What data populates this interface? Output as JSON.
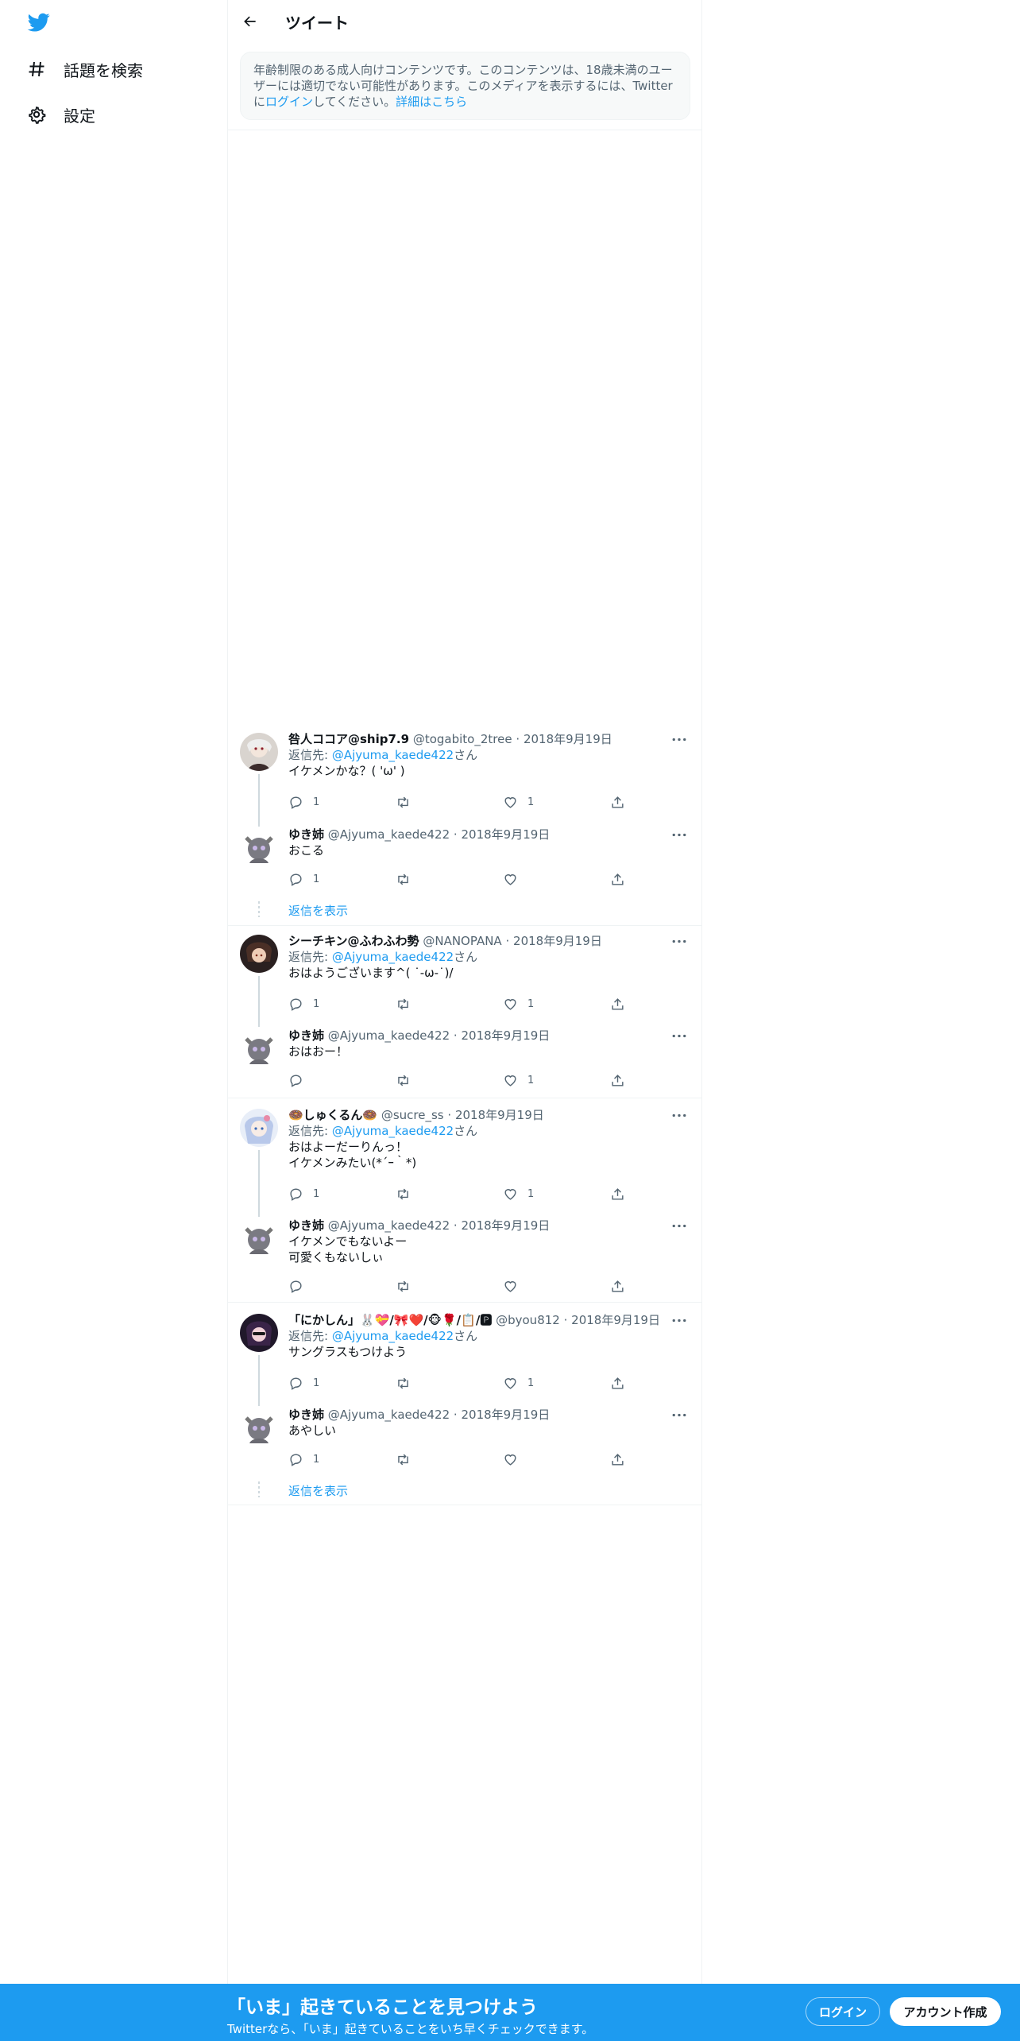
{
  "nav": {
    "explore_label": "話題を検索",
    "settings_label": "設定"
  },
  "header": {
    "title": "ツイート"
  },
  "notice": {
    "text1": "年齢制限のある成人向けコンテンツです。このコンテンツは、18歳未満のユーザーには適切でない可能性があります。このメディアを表示するには、Twitter",
    "text2": "に",
    "login_link": "ログイン",
    "text3": "してください。",
    "learn_more": "詳細はこちら"
  },
  "threads": [
    {
      "reply": {
        "name": "咎人ココア@ship7.9",
        "handle": "@togabito_2tree",
        "date": "2018年9月19日",
        "reply_prefix": "返信先: ",
        "reply_to": "@Ajyuma_kaede422",
        "reply_suffix": "さん",
        "text": "イケメンかな？( 'ω' )",
        "replies": "1",
        "retweets": "",
        "likes": "1"
      },
      "answer": {
        "name": "ゆき姉",
        "handle": "@Ajyuma_kaede422",
        "date": "2018年9月19日",
        "text": "おこる",
        "replies": "1",
        "retweets": "",
        "likes": ""
      },
      "show_replies": "返信を表示"
    },
    {
      "reply": {
        "name": "シーチキン@ふわふわ勢",
        "handle": "@NANOPANA",
        "date": "2018年9月19日",
        "reply_prefix": "返信先: ",
        "reply_to": "@Ajyuma_kaede422",
        "reply_suffix": "さん",
        "text": "おはようございます^( ˙-ω-˙)/",
        "replies": "1",
        "retweets": "",
        "likes": "1"
      },
      "answer": {
        "name": "ゆき姉",
        "handle": "@Ajyuma_kaede422",
        "date": "2018年9月19日",
        "text": "おはおー！",
        "replies": "",
        "retweets": "",
        "likes": "1"
      }
    },
    {
      "reply": {
        "name": "🍩しゅくるん🍩",
        "handle": "@sucre_ss",
        "date": "2018年9月19日",
        "reply_prefix": "返信先: ",
        "reply_to": "@Ajyuma_kaede422",
        "reply_suffix": "さん",
        "text_line1": "おはよーだーりんっ！",
        "text_line2": "イケメンみたい(*´ｰ｀*)",
        "replies": "1",
        "retweets": "",
        "likes": "1"
      },
      "answer": {
        "name": "ゆき姉",
        "handle": "@Ajyuma_kaede422",
        "date": "2018年9月19日",
        "text_line1": "イケメンでもないよー",
        "text_line2": "可愛くもないしぃ",
        "replies": "",
        "retweets": "",
        "likes": ""
      }
    },
    {
      "reply": {
        "name": "「にかしん」🐰💝/🎀❤️/🐵🌹/📋/🅿",
        "handle": "@byou812",
        "date": "2018年9月19日",
        "reply_prefix": "返信先: ",
        "reply_to": "@Ajyuma_kaede422",
        "reply_suffix": "さん",
        "text": "サングラスもつけよう",
        "replies": "1",
        "retweets": "",
        "likes": "1"
      },
      "answer": {
        "name": "ゆき姉",
        "handle": "@Ajyuma_kaede422",
        "date": "2018年9月19日",
        "text": "あやしい",
        "replies": "1",
        "retweets": "",
        "likes": ""
      },
      "show_replies": "返信を表示"
    }
  ],
  "separator_dot": "·",
  "bottom": {
    "title": "「いま」起きていることを見つけよう",
    "subtitle": "Twitterなら、「いま」起きていることをいち早くチェックできます。",
    "login": "ログイン",
    "signup": "アカウント作成"
  },
  "colors": {
    "accent": "#1d9bf0",
    "muted": "#536471",
    "border": "#eff3f4"
  },
  "icons": [
    "twitter-logo-icon",
    "hashtag-icon",
    "gear-icon",
    "back-arrow-icon",
    "more-icon",
    "reply-icon",
    "retweet-icon",
    "like-icon",
    "share-icon"
  ]
}
